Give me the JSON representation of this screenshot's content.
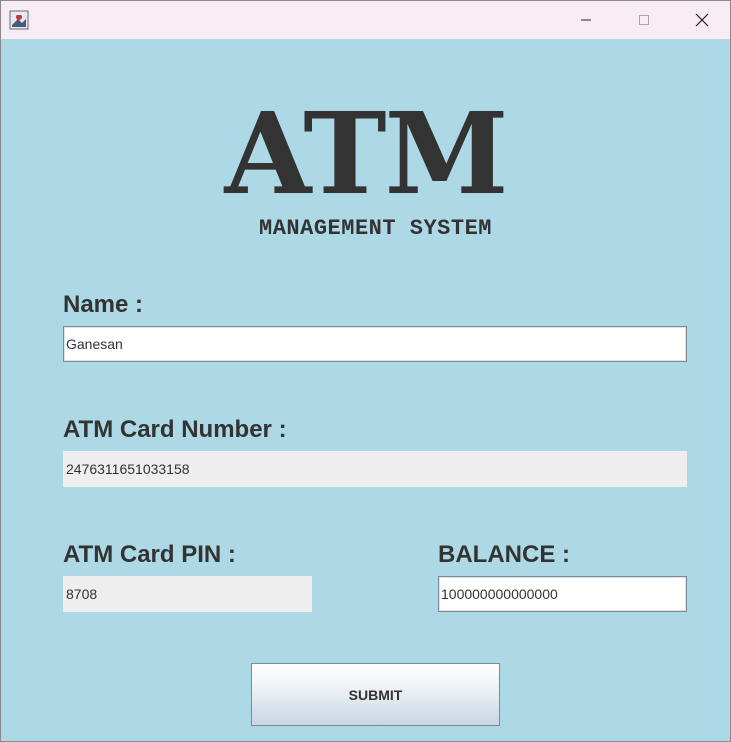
{
  "window": {
    "minimize_icon": "minimize-icon",
    "maximize_icon": "maximize-icon",
    "close_icon": "close-icon",
    "app_icon": "java-app-icon"
  },
  "logo": {
    "title": "ATM",
    "subtitle": "MANAGEMENT SYSTEM"
  },
  "form": {
    "name_label": "Name :",
    "name_value": "Ganesan",
    "card_number_label": "ATM Card Number :",
    "card_number_value": "2476311651033158",
    "pin_label": "ATM Card PIN :",
    "pin_value": "8708",
    "balance_label": "BALANCE :",
    "balance_value": "100000000000000",
    "submit_label": "SUBMIT"
  },
  "colors": {
    "background": "#add8e6",
    "titlebar": "#f7ecf4",
    "text": "#333333",
    "readonly_field": "#eeeeee"
  }
}
